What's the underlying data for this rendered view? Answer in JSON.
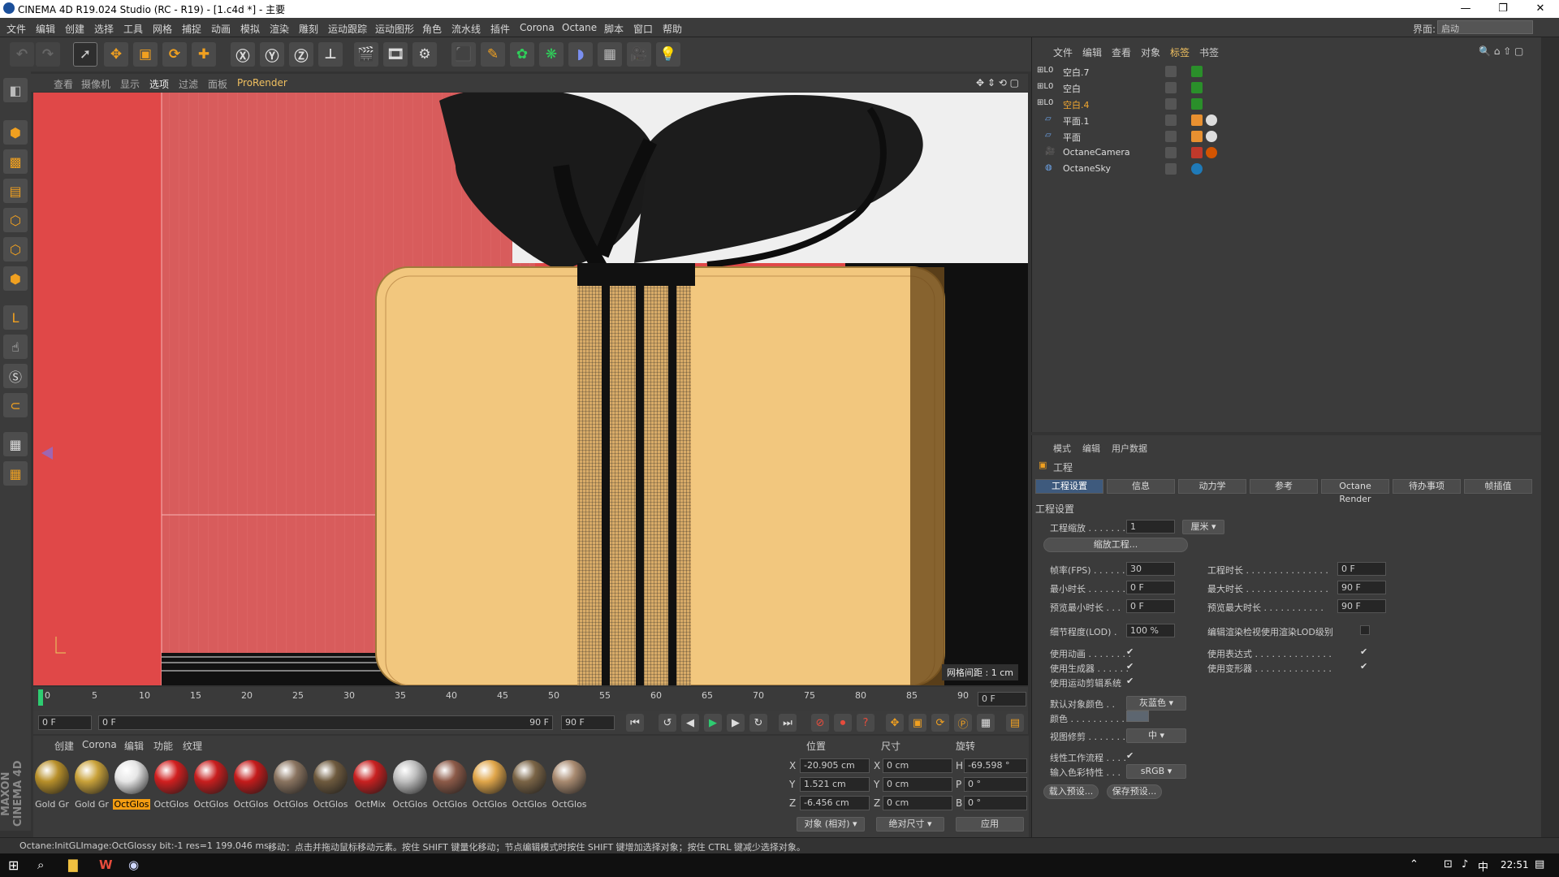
{
  "window": {
    "title": "CINEMA 4D R19.024 Studio (RC - R19) - [1.c4d *] - 主要"
  },
  "menu": {
    "items": [
      "文件",
      "编辑",
      "创建",
      "选择",
      "工具",
      "网格",
      "捕捉",
      "动画",
      "模拟",
      "渲染",
      "雕刻",
      "运动跟踪",
      "运动图形",
      "角色",
      "流水线",
      "插件",
      "Corona",
      "Octane",
      "脚本",
      "窗口",
      "帮助"
    ],
    "layout_label": "界面:",
    "layout_value": "启动"
  },
  "viewport": {
    "menu": [
      "查看",
      "摄像机",
      "显示",
      "选项",
      "过滤",
      "面板",
      "ProRender"
    ],
    "grid_info": "网格间距 : 1 cm"
  },
  "timeline": {
    "ticks": [
      "0",
      "5",
      "10",
      "15",
      "20",
      "25",
      "30",
      "35",
      "40",
      "45",
      "50",
      "55",
      "60",
      "65",
      "70",
      "75",
      "80",
      "85",
      "90"
    ],
    "end_frame": "0 F"
  },
  "transport": {
    "start": "0 F",
    "range_start": "0 F",
    "range_end": "90 F",
    "end": "90 F"
  },
  "materials": {
    "menu": [
      "创建",
      "Corona",
      "编辑",
      "功能",
      "纹理"
    ],
    "items": [
      {
        "label": "Gold Gr",
        "color": "#b8902a"
      },
      {
        "label": "Gold Gr",
        "color": "#c9a23a"
      },
      {
        "label": "OctGlos",
        "color": "#e6e6e6",
        "selected": true
      },
      {
        "label": "OctGlos",
        "color": "#d11f1f"
      },
      {
        "label": "OctGlos",
        "color": "#c81e1e"
      },
      {
        "label": "OctGlos",
        "color": "#c41b1b"
      },
      {
        "label": "OctGlos",
        "color": "#8a7460"
      },
      {
        "label": "OctGlos",
        "color": "#6e5a3e"
      },
      {
        "label": "OctMix",
        "color": "#c82020"
      },
      {
        "label": "OctGlos",
        "color": "#bfbfbf"
      },
      {
        "label": "OctGlos",
        "color": "#8c5a48"
      },
      {
        "label": "OctGlos",
        "color": "#e0a64a"
      },
      {
        "label": "OctGlos",
        "color": "#7a6446"
      },
      {
        "label": "OctGlos",
        "color": "#a88a70"
      }
    ]
  },
  "coords": {
    "headers": {
      "pos": "位置",
      "size": "尺寸",
      "rot": "旋转"
    },
    "rows": [
      {
        "axis": "X",
        "pos": "-20.905 cm",
        "saxis": "X",
        "size": "0 cm",
        "raxis": "H",
        "rot": "-69.598 °"
      },
      {
        "axis": "Y",
        "pos": "1.521 cm",
        "saxis": "Y",
        "size": "0 cm",
        "raxis": "P",
        "rot": "0 °"
      },
      {
        "axis": "Z",
        "pos": "-6.456 cm",
        "saxis": "Z",
        "size": "0 cm",
        "raxis": "B",
        "rot": "0 °"
      }
    ],
    "mode1": "对象 (相对)",
    "mode2": "绝对尺寸",
    "apply": "应用"
  },
  "objects": {
    "menu": [
      "文件",
      "编辑",
      "查看",
      "对象",
      "标签",
      "书签"
    ],
    "items": [
      {
        "name": "空白.7",
        "color": "#ddd"
      },
      {
        "name": "空白",
        "color": "#ddd"
      },
      {
        "name": "空白.4",
        "color": "#f3a830"
      },
      {
        "name": "平面.1",
        "color": "#ddd"
      },
      {
        "name": "平面",
        "color": "#ddd"
      },
      {
        "name": "OctaneCamera",
        "color": "#ddd"
      },
      {
        "name": "OctaneSky",
        "color": "#ddd"
      }
    ]
  },
  "attributes": {
    "menu": [
      "模式",
      "编辑",
      "用户数据"
    ],
    "title": "工程",
    "tabs": [
      "工程设置",
      "信息",
      "动力学",
      "参考",
      "Octane Render",
      "待办事项",
      "帧插值"
    ],
    "section": "工程设置",
    "scale_label": "工程缩放 . . . . . . .",
    "scale_value": "1",
    "scale_unit": "厘米",
    "scale_btn": "缩放工程...",
    "fps_label": "帧率(FPS) . . . . . . .",
    "fps": "30",
    "proj_len_label": "工程时长 . . . . . . . . . . . . . . .",
    "proj_len": "0 F",
    "min_label": "最小时长 . . . . . . .",
    "min": "0 F",
    "max_label": "最大时长 . . . . . . . . . . . . . . .",
    "max": "90 F",
    "pmin_label": "预览最小时长 . . .",
    "pmin": "0 F",
    "pmax_label": "预览最大时长 . . . . . . . . . . .",
    "pmax": "90 F",
    "lod_label": "细节程度(LOD) .",
    "lod": "100 %",
    "lod_render_label": "编辑渲染检视使用渲染LOD级别",
    "anim_label": "使用动画 . . . . . . . .",
    "expr_label": "使用表达式 . . . . . . . . . . . . . .",
    "gen_label": "使用生成器 . . . . . .",
    "deform_label": "使用变形器 . . . . . . . . . . . . . .",
    "motion_label": "使用运动剪辑系统",
    "defcolor_label": "默认对象颜色 . .",
    "defcolor": "灰蓝色",
    "color_label": "颜色 . . . . . . . . . .",
    "clip_label": "视图修剪 . . . . . . .",
    "clip": "中",
    "linear_label": "线性工作流程 . . . .",
    "input_label": "输入色彩特性 . . .",
    "input": "sRGB",
    "load_btn": "载入预设...",
    "save_btn": "保存预设..."
  },
  "status": {
    "left": "Octane:InitGLImage:OctGlossy  bit:-1 res=1  199.046 ms.",
    "right": "移动：点击并拖动鼠标移动元素。按住 SHIFT 键量化移动；节点编辑模式时按住 SHIFT 键增加选择对象；按住 CTRL 键减少选择对象。"
  },
  "taskbar": {
    "time": "22:51",
    "ime": "中"
  }
}
